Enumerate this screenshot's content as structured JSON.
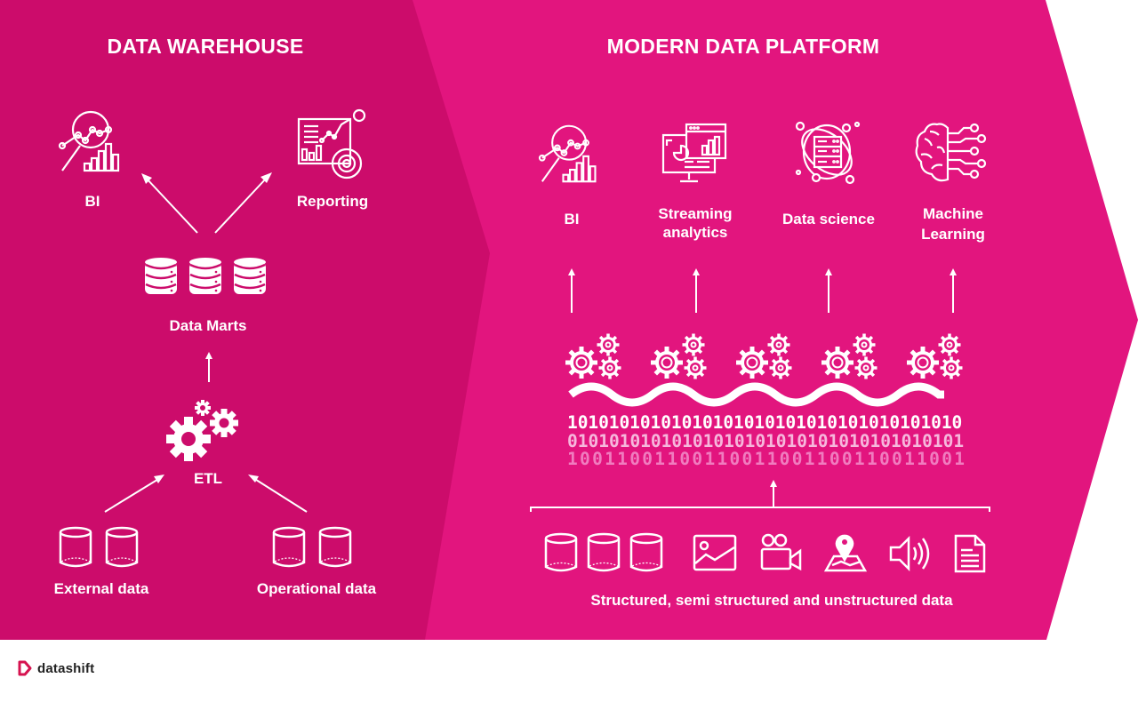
{
  "colors": {
    "left_panel": "#cc0c6b",
    "right_panel": "#e2157e",
    "foreground": "#ffffff",
    "logo_accent": "#d6124f",
    "logo_text": "#222222"
  },
  "left": {
    "title": "DATA WAREHOUSE",
    "outputs": [
      {
        "label": "BI",
        "icon": "bi-analytics-icon"
      },
      {
        "label": "Reporting",
        "icon": "reporting-dashboard-icon"
      }
    ],
    "data_marts": {
      "label": "Data Marts",
      "icon": "database-stack-icon",
      "count": 3
    },
    "etl": {
      "label": "ETL",
      "icon": "gears-icon"
    },
    "sources": [
      {
        "label": "External data",
        "icon": "cylinder-icon",
        "count": 2
      },
      {
        "label": "Operational data",
        "icon": "cylinder-icon",
        "count": 2
      }
    ]
  },
  "right": {
    "title": "MODERN DATA PLATFORM",
    "outputs": [
      {
        "label_lines": [
          "BI"
        ],
        "icon": "bi-analytics-icon"
      },
      {
        "label_lines": [
          "Streaming",
          "analytics"
        ],
        "icon": "monitor-dashboard-icon"
      },
      {
        "label_lines": [
          "Data science"
        ],
        "icon": "server-orbit-icon"
      },
      {
        "label_lines": [
          "Machine",
          "Learning"
        ],
        "icon": "brain-circuit-icon"
      }
    ],
    "processing_gear_groups": 5,
    "binary_rows": [
      "10101010101010101010101010101010101010",
      "01010101010101010101010101010101010101",
      "10011001100110011001100110011001"
    ],
    "sources_label": "Structured, semi structured and unstructured data",
    "source_icons": [
      "cylinder-icon",
      "cylinder-icon",
      "cylinder-icon",
      "image-icon",
      "video-camera-icon",
      "map-pin-icon",
      "speaker-icon",
      "document-icon"
    ]
  },
  "footer": {
    "brand": "datashift",
    "brand_icon": "datashift-logo-icon"
  }
}
